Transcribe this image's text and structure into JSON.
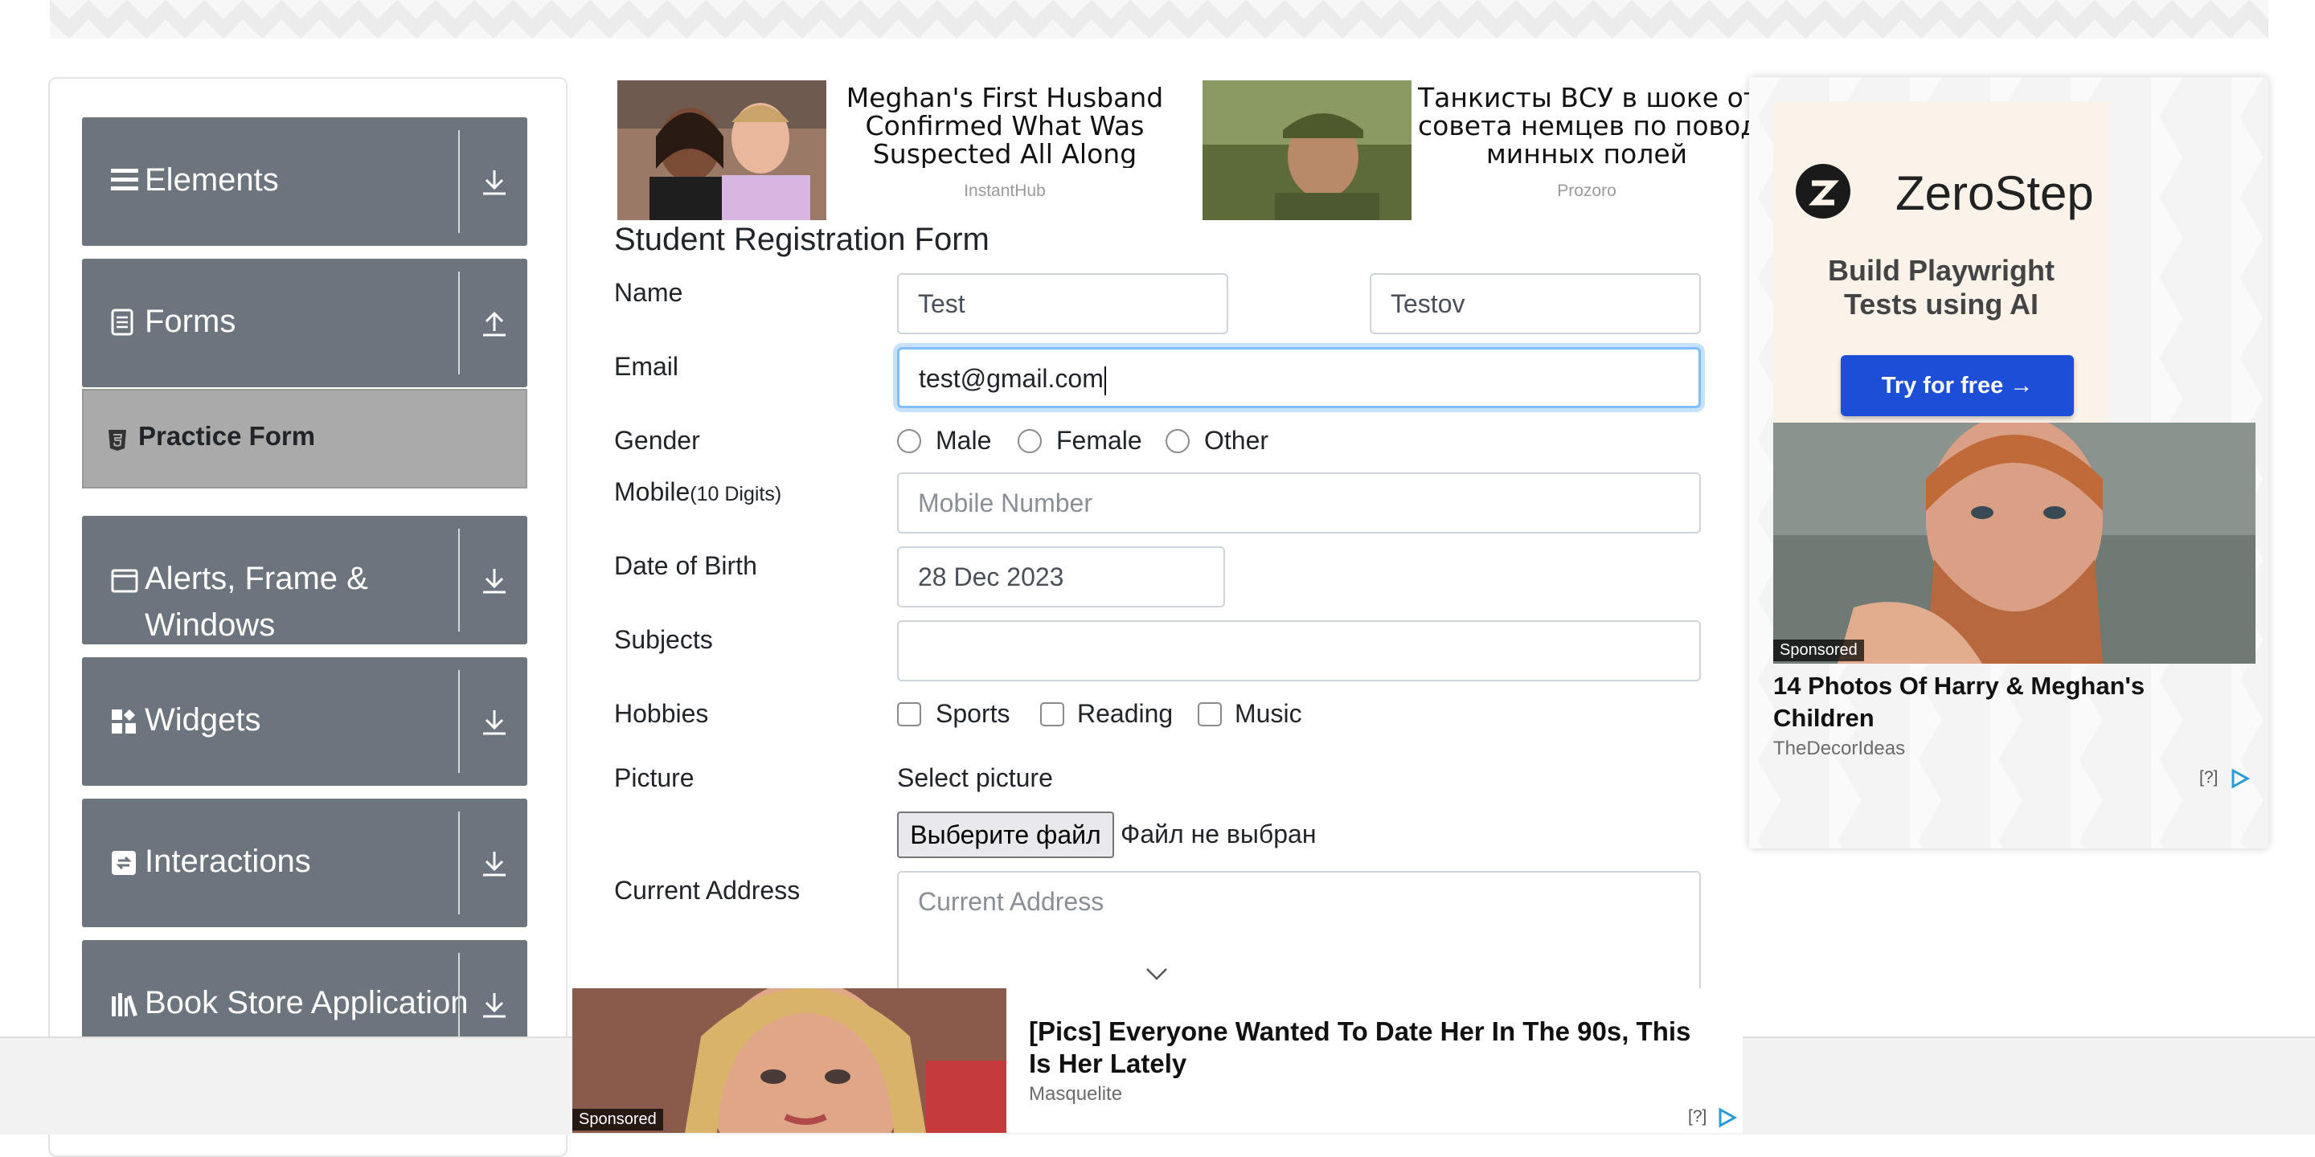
{
  "sidebar": {
    "groups": [
      {
        "label": "Elements",
        "icon": "hamburger-icon",
        "arrow": "download"
      },
      {
        "label": "Forms",
        "icon": "document-icon",
        "arrow": "upload"
      },
      {
        "label": "Alerts, Frame &",
        "label2": "Windows",
        "icon": "window-icon",
        "arrow": "download"
      },
      {
        "label": "Widgets",
        "icon": "widgets-icon",
        "arrow": "download"
      },
      {
        "label": "Interactions",
        "icon": "interactions-icon",
        "arrow": "download"
      },
      {
        "label": "Book Store Application",
        "icon": "books-icon",
        "arrow": "download"
      }
    ],
    "active_item": {
      "label": "Practice Form",
      "icon": "html5-icon"
    }
  },
  "top_ads": [
    {
      "title_lines": [
        "Meghan's First Husband",
        "Confirmed What Was",
        "Suspected All Along"
      ],
      "source": "InstantHub"
    },
    {
      "title_lines": [
        "Танкисты ВСУ в шоке от",
        "совета немцев по поводу",
        "минных полей"
      ],
      "source": "Prozoro"
    }
  ],
  "form": {
    "title": "Student Registration Form",
    "labels": {
      "name": "Name",
      "email": "Email",
      "gender": "Gender",
      "mobile": "Mobile",
      "mobile_hint": "(10 Digits)",
      "dob": "Date of Birth",
      "subjects": "Subjects",
      "hobbies": "Hobbies",
      "picture": "Picture",
      "address": "Current Address"
    },
    "first_name": "Test",
    "last_name": "Testov",
    "email": "test@gmail.com",
    "gender_options": [
      "Male",
      "Female",
      "Other"
    ],
    "mobile_placeholder": "Mobile Number",
    "dob": "28 Dec 2023",
    "subjects": "",
    "hobby_options": [
      "Sports",
      "Reading",
      "Music"
    ],
    "picture_prompt": "Select picture",
    "file_button": "Выберите файл",
    "file_status": "Файл не выбран",
    "address_placeholder": "Current Address"
  },
  "right_ad": {
    "brand": "ZeroStep",
    "tagline_lines": [
      "Build Playwright",
      "Tests using AI"
    ],
    "cta": "Try for free →",
    "sponsored": "Sponsored",
    "title": "14 Photos Of Harry & Meghan's Children",
    "source": "TheDecorIdeas",
    "adchoice": "[?]"
  },
  "bottom_ad": {
    "sponsored": "Sponsored",
    "title": "[Pics] Everyone Wanted To Date Her In The 90s, This Is Her Lately",
    "source": "Masquelite",
    "adchoice": "[?]"
  },
  "colors": {
    "sidebar_group": "#6c757d",
    "active_item": "#aaaaaa",
    "focus_border": "#80bdff",
    "cta_blue": "#1c4ed8"
  }
}
